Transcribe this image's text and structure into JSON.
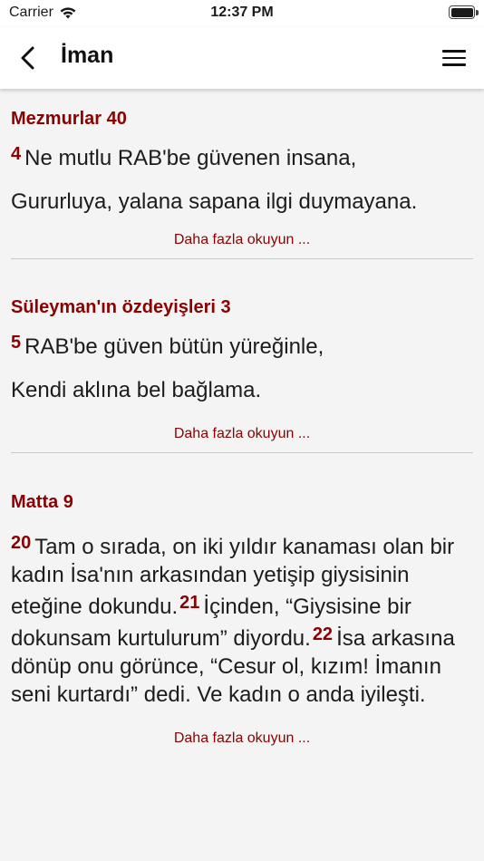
{
  "status_bar": {
    "carrier": "Carrier",
    "time": "12:37 PM"
  },
  "nav": {
    "title": "İman"
  },
  "cards": [
    {
      "reference": "Mezmurlar 40",
      "verse_num": "4",
      "line1": "Ne mutlu RAB'be güvenen insana,",
      "line2": "Gururluya, yalana sapana ilgi duymayana.",
      "read_more": "Daha fazla okuyun ..."
    },
    {
      "reference": "Süleyman'ın özdeyişleri 3",
      "verse_num": "5",
      "line1": "RAB'be güven bütün yüreğinle,",
      "line2": "Kendi aklına bel bağlama.",
      "read_more": "Daha fazla okuyun ..."
    },
    {
      "reference": "Matta 9",
      "verse_num_1": "20",
      "text_1": "Tam o sırada, on iki yıldır kanaması olan bir kadın İsa'nın arkasından yetişip giysisinin eteğine dokundu.",
      "verse_num_2": "21",
      "text_2": "İçinden, “Giysisine bir dokunsam kurtulurum” diyordu.",
      "verse_num_3": "22",
      "text_3": "İsa arkasına dönüp onu görünce, “Cesur ol, kızım! İmanın seni kurtardı” dedi. Ve kadın o anda iyileşti.",
      "read_more": "Daha fazla okuyun ..."
    }
  ],
  "icons": {
    "back": "chevron-left-icon",
    "menu": "hamburger-menu-icon",
    "wifi": "wifi-icon",
    "battery": "battery-icon"
  },
  "colors": {
    "accent": "#8b0000",
    "background": "#f4f4f4",
    "bar": "#ffffff"
  }
}
